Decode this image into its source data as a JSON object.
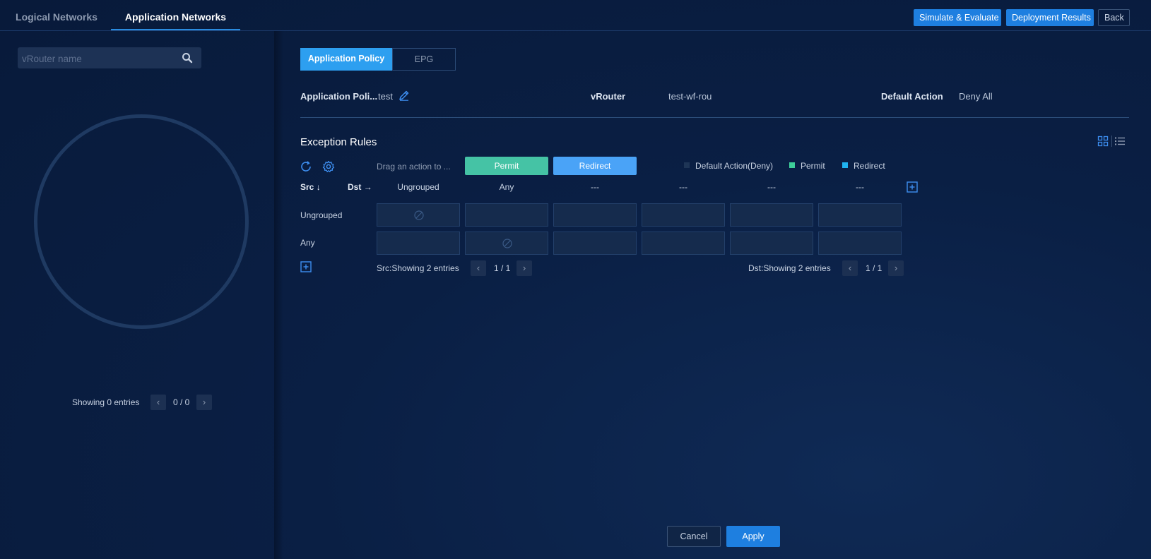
{
  "tabs": [
    {
      "label": "Logical Networks",
      "active": false
    },
    {
      "label": "Application Networks",
      "active": true
    }
  ],
  "top_buttons": {
    "simulate": "Simulate & Evaluate",
    "deployment": "Deployment Results",
    "back": "Back"
  },
  "sidebar": {
    "search_placeholder": "vRouter name",
    "pager": {
      "text": "Showing 0 entries",
      "page": "0 / 0"
    }
  },
  "subtabs": [
    {
      "label": "Application Policy",
      "active": true
    },
    {
      "label": "EPG",
      "active": false
    }
  ],
  "info": {
    "policy_label": "Application Poli...",
    "policy_value": "test",
    "vrouter_label": "vRouter",
    "vrouter_value": "test-wf-rou",
    "default_action_label": "Default Action",
    "default_action_value": "Deny All"
  },
  "exception_rules": {
    "title": "Exception Rules",
    "drag_hint": "Drag an action to ...",
    "actions": [
      {
        "label": "Permit",
        "color": "#45c3a5"
      },
      {
        "label": "Redirect",
        "color": "#4aa3f7"
      }
    ],
    "legend": [
      {
        "label": "Default Action(Deny)",
        "color": "#1e3556"
      },
      {
        "label": "Permit",
        "color": "#3ecf9a"
      },
      {
        "label": "Redirect",
        "color": "#1fb3f0"
      }
    ],
    "src_label": "Src",
    "dst_label": "Dst",
    "columns": [
      "Ungrouped",
      "Any",
      "---",
      "---",
      "---",
      "---"
    ],
    "rows": [
      {
        "label": "Ungrouped",
        "cells": [
          "deny-icon",
          "",
          "",
          "",
          "",
          ""
        ]
      },
      {
        "label": "Any",
        "cells": [
          "",
          "deny-icon",
          "",
          "",
          "",
          ""
        ]
      }
    ],
    "src_pager": {
      "text": "Src:Showing 2 entries",
      "page": "1 / 1"
    },
    "dst_pager": {
      "text": "Dst:Showing 2 entries",
      "page": "1 / 1"
    }
  },
  "footer": {
    "cancel": "Cancel",
    "apply": "Apply"
  },
  "colors": {
    "accent": "#1e7fe0",
    "background": "#0a1f44"
  }
}
